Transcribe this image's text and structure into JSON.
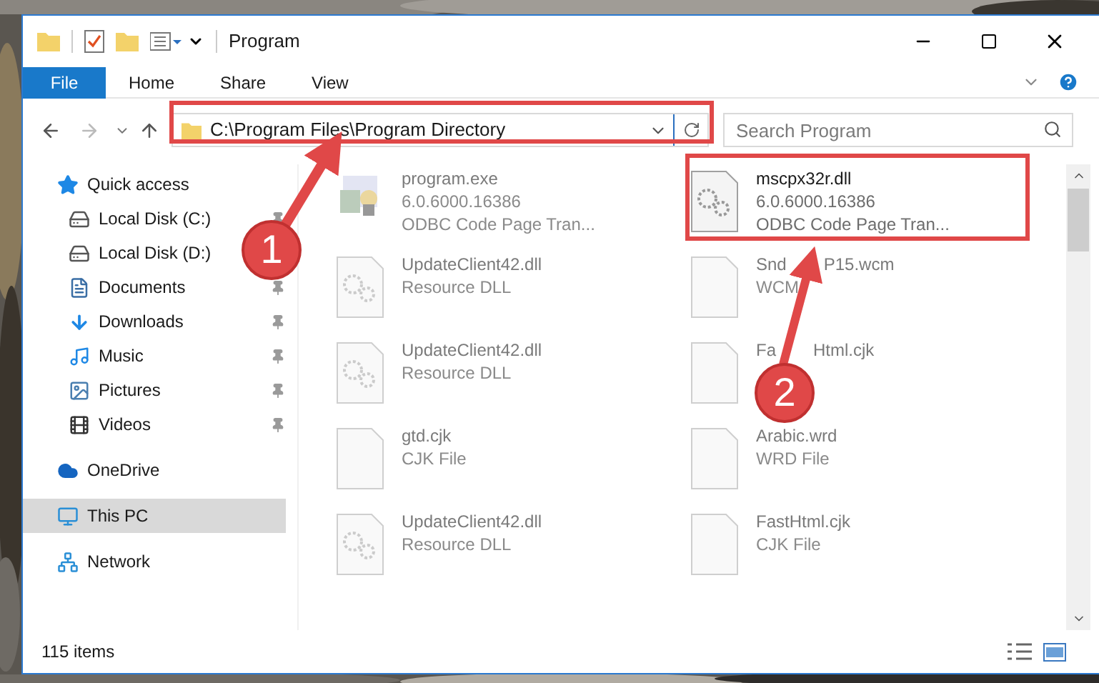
{
  "window": {
    "title": "Program"
  },
  "ribbon_tabs": [
    {
      "label": "File",
      "selected": true
    },
    {
      "label": "Home",
      "selected": false
    },
    {
      "label": "Share",
      "selected": false
    },
    {
      "label": "View",
      "selected": false
    }
  ],
  "address_bar": {
    "value": "C:\\Program Files\\Program Directory"
  },
  "search": {
    "placeholder": "Search Program"
  },
  "sidebar": {
    "items": [
      {
        "label": "Quick access",
        "selected": false,
        "children": [
          {
            "label": "Local Disk (C:)",
            "selected": false,
            "pinned": true
          },
          {
            "label": "Local Disk (D:)",
            "selected": false
          },
          {
            "label": "Documents",
            "selected": false,
            "pinned": true
          },
          {
            "label": "Downloads",
            "selected": false,
            "pinned": true
          },
          {
            "label": "Music",
            "selected": false,
            "pinned": true
          },
          {
            "label": "Pictures",
            "selected": false,
            "pinned": true
          },
          {
            "label": "Videos",
            "selected": false,
            "pinned": true
          }
        ]
      },
      {
        "label": "OneDrive",
        "selected": false
      },
      {
        "label": "This PC",
        "selected": true
      },
      {
        "label": "Network",
        "selected": false
      }
    ]
  },
  "files": [
    {
      "name": [
        "program.exe"
      ],
      "lines": [
        [
          "6.0.6000.16386"
        ],
        [
          "ODBC Code Page Tran..."
        ]
      ],
      "kind": "app",
      "faded": true
    },
    {
      "name": [
        "mscpx32r.dll"
      ],
      "lines": [
        [
          "6.0.6000.16386"
        ],
        [
          "ODBC Code Page Tran..."
        ]
      ],
      "kind": "gear",
      "faded": false
    },
    {
      "name": [
        "UpdateClient42.dll"
      ],
      "lines": [
        [
          "Resource DLL"
        ]
      ],
      "kind": "gear",
      "faded": true
    },
    {
      "name": [
        "Snd",
        "P15.wcm"
      ],
      "lines": [
        [
          "WCM"
        ]
      ],
      "kind": "blank",
      "faded": true
    },
    {
      "name": [
        "UpdateClient42.dll"
      ],
      "lines": [
        [
          "Resource DLL"
        ]
      ],
      "kind": "gear",
      "faded": true
    },
    {
      "name": [
        "Fa",
        "Html.cjk"
      ],
      "kind": "blank",
      "faded": true
    },
    {
      "name": [
        "gtd.cjk"
      ],
      "lines": [
        [
          "CJK File"
        ]
      ],
      "kind": "blank",
      "faded": true
    },
    {
      "name": [
        "Arabic.wrd"
      ],
      "lines": [
        [
          "WRD File"
        ]
      ],
      "kind": "blank",
      "faded": true
    },
    {
      "name": [
        "UpdateClient42.dll"
      ],
      "lines": [
        [
          "Resource DLL"
        ]
      ],
      "kind": "gear",
      "faded": true
    },
    {
      "name": [
        "FastHtml.cjk"
      ],
      "lines": [
        [
          "CJK File"
        ]
      ],
      "kind": "blank",
      "faded": true
    }
  ],
  "status_bar": {
    "item_count": "115 items"
  },
  "callouts": [
    "1",
    "2"
  ]
}
